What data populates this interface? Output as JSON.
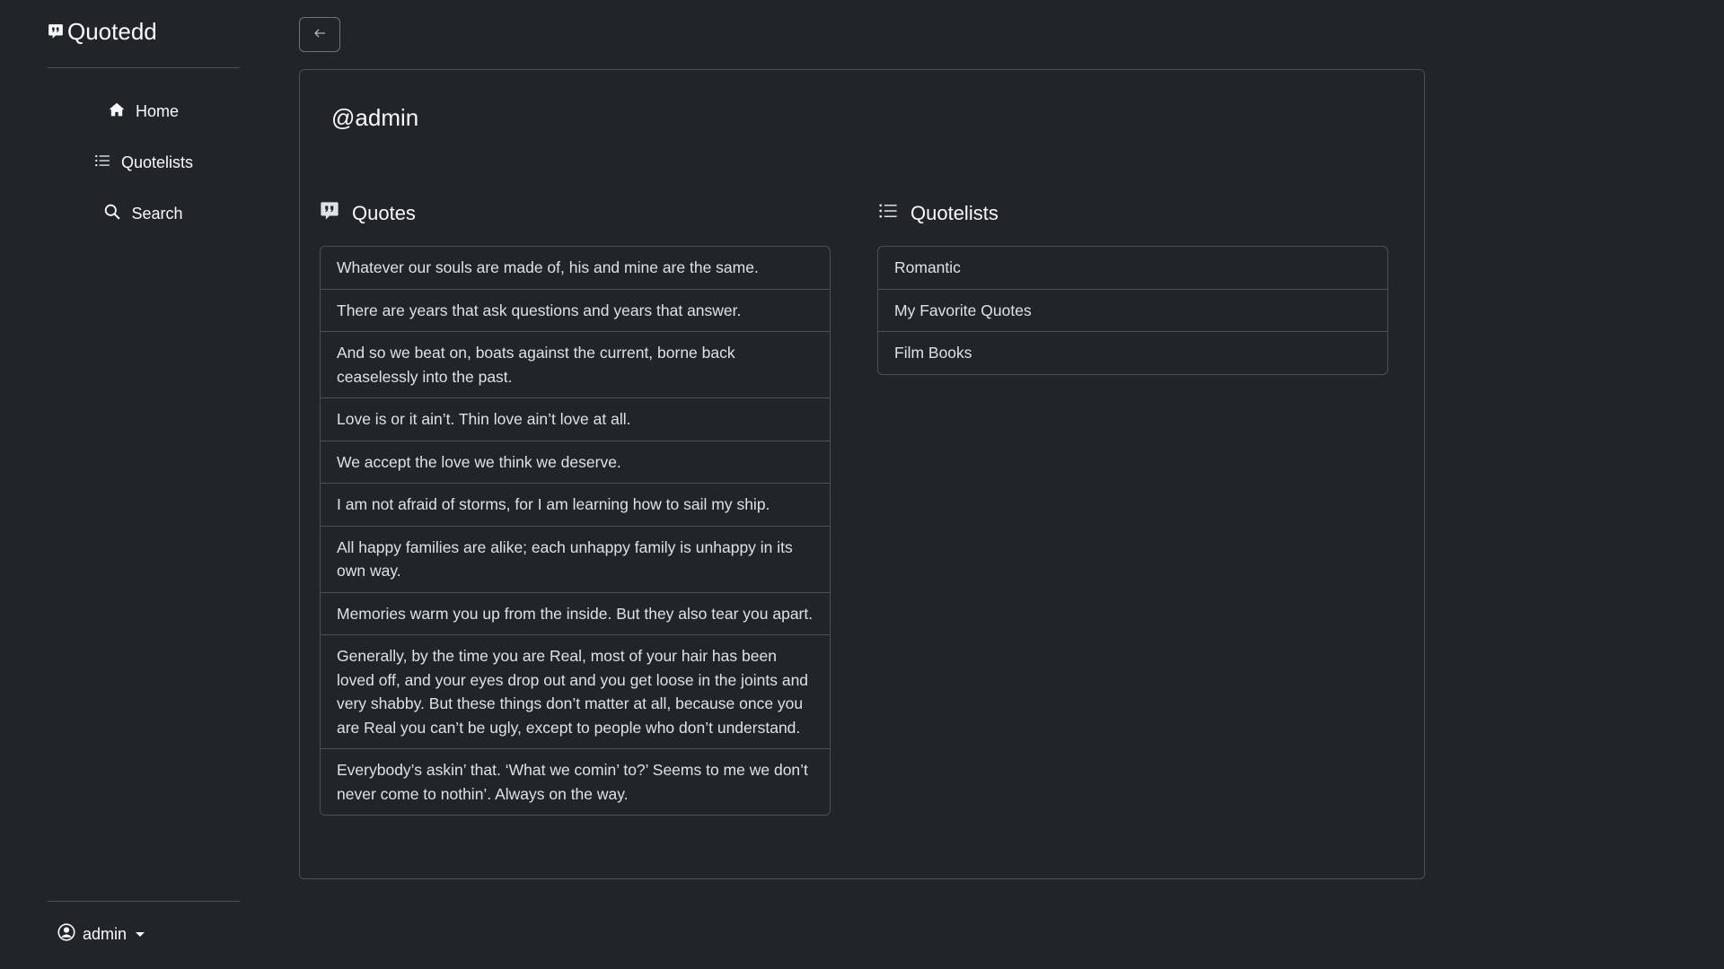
{
  "app": {
    "name": "Quotedd"
  },
  "nav": {
    "items": [
      {
        "label": "Home",
        "icon": "home-icon"
      },
      {
        "label": "Quotelists",
        "icon": "list-icon"
      },
      {
        "label": "Search",
        "icon": "search-icon"
      }
    ]
  },
  "user": {
    "name": "admin"
  },
  "profile": {
    "username": "@admin"
  },
  "quotes": {
    "heading": "Quotes",
    "items": [
      "Whatever our souls are made of, his and mine are the same.",
      "There are years that ask questions and years that answer.",
      "And so we beat on, boats against the current, borne back ceaselessly into the past.",
      "Love is or it ain’t. Thin love ain’t love at all.",
      "We accept the love we think we deserve.",
      "I am not afraid of storms, for I am learning how to sail my ship.",
      "All happy families are alike; each unhappy family is unhappy in its own way.",
      "Memories warm you up from the inside. But they also tear you apart.",
      "Generally, by the time you are Real, most of your hair has been loved off, and your eyes drop out and you get loose in the joints and very shabby. But these things don’t matter at all, because once you are Real you can’t be ugly, except to people who don’t understand.",
      "Everybody’s askin’ that. ‘What we comin’ to?’ Seems to me we don’t never come to nothin’. Always on the way."
    ]
  },
  "quotelists": {
    "heading": "Quotelists",
    "items": [
      "Romantic",
      "My Favorite Quotes",
      "Film Books"
    ]
  },
  "colors": {
    "background": "#212529",
    "border": "#495057",
    "text": "#dee2e6"
  }
}
